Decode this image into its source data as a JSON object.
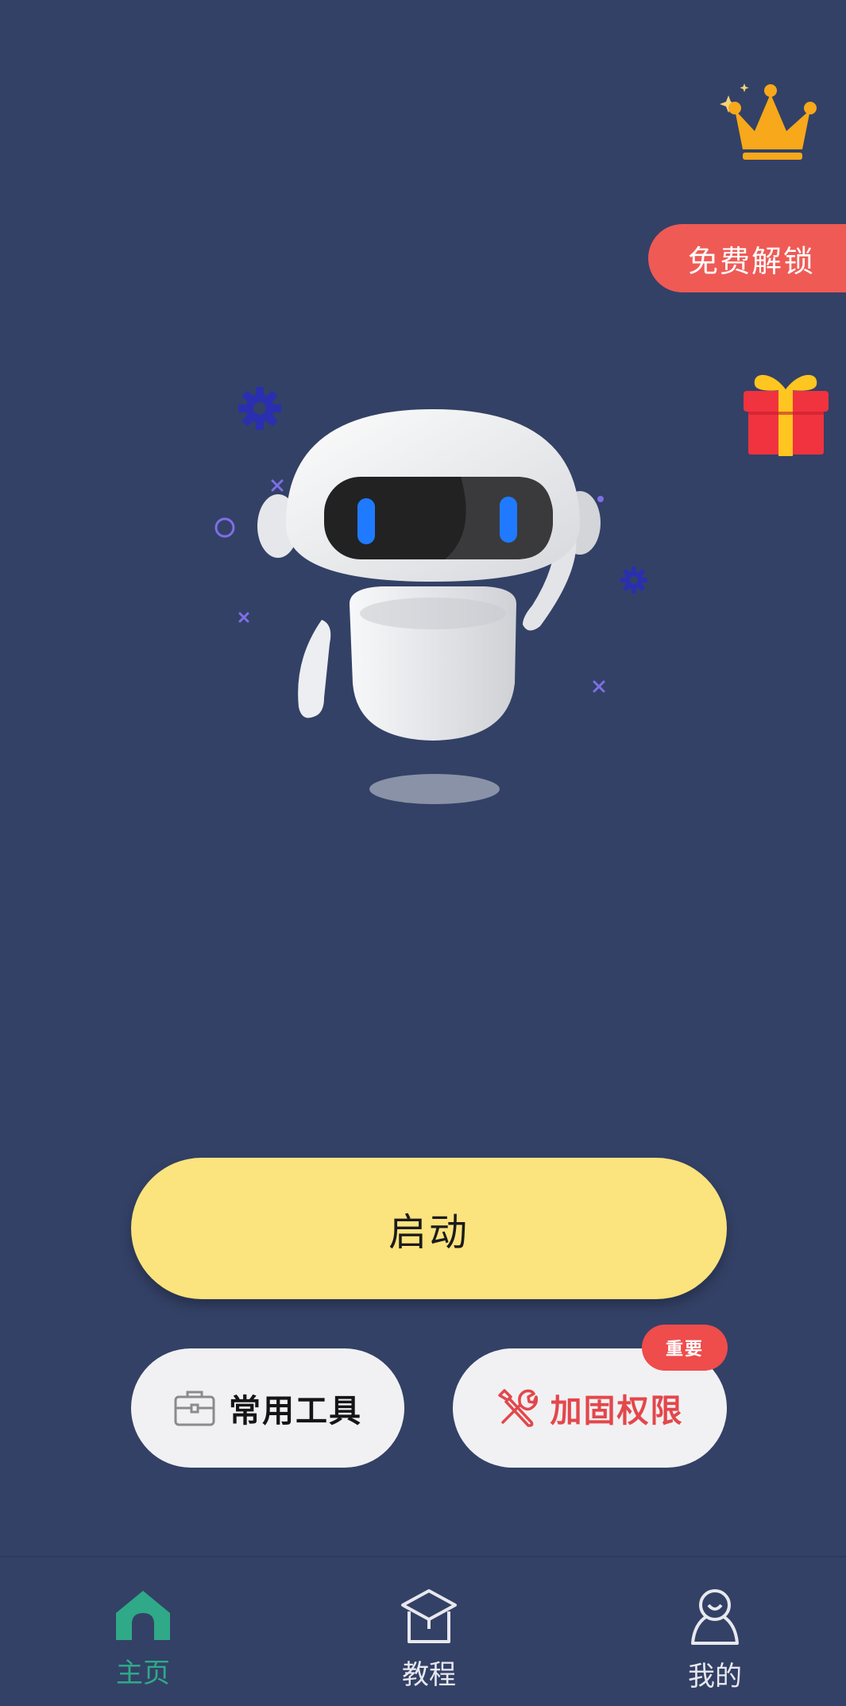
{
  "header": {
    "unlock_label": "免费解锁"
  },
  "main": {
    "start_label": "启动",
    "tools_label": "常用工具",
    "secure_label": "加固权限",
    "important_badge": "重要"
  },
  "nav": {
    "items": [
      {
        "label": "主页",
        "icon": "home-icon",
        "active": true
      },
      {
        "label": "教程",
        "icon": "graduation-cap-icon",
        "active": false
      },
      {
        "label": "我的",
        "icon": "user-icon",
        "active": false
      }
    ]
  },
  "colors": {
    "background": "#334166",
    "start_button": "#fbe37e",
    "unlock_button": "#ef5a55",
    "accent_red": "#e3474b",
    "active_nav": "#2fa988"
  }
}
